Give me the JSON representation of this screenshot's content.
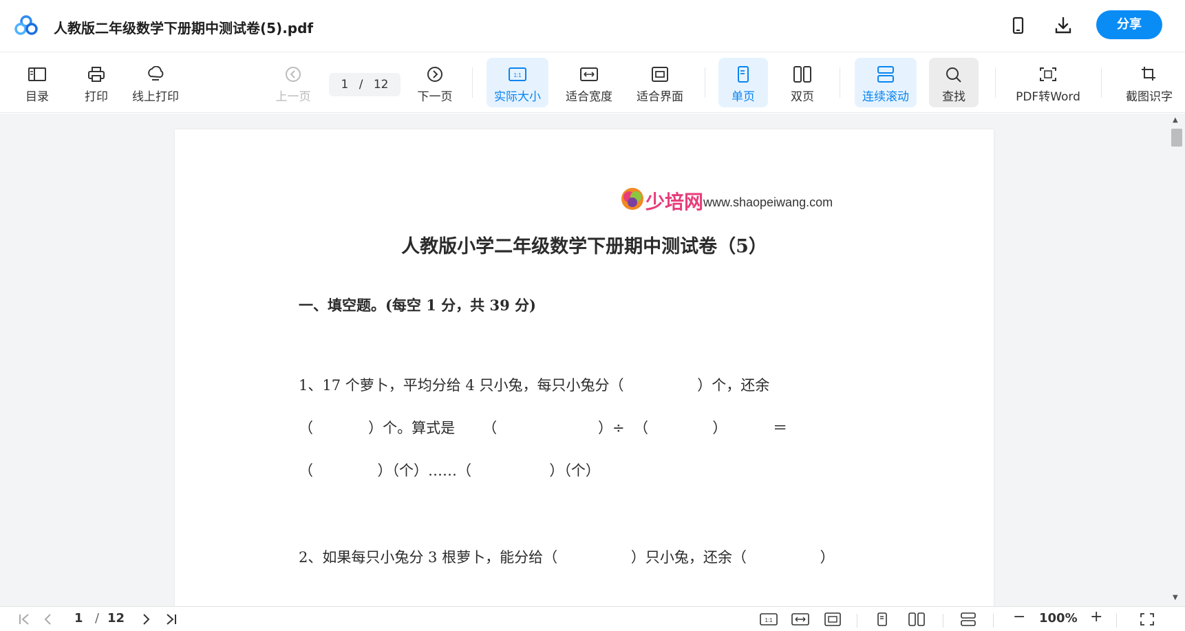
{
  "app": {
    "file_title": "人教版二年级数学下册期中测试卷(5).pdf",
    "share_label": "分享",
    "accent": "#0a8cf5"
  },
  "toolbar": {
    "toc": "目录",
    "print": "打印",
    "online_print": "线上打印",
    "prev_page": "上一页",
    "page_current": "1",
    "page_sep": "/",
    "page_total": "12",
    "next_page": "下一页",
    "actual_size": "实际大小",
    "fit_width": "适合宽度",
    "fit_screen": "适合界面",
    "single_page": "单页",
    "double_page": "双页",
    "continuous_scroll": "连续滚动",
    "find": "查找",
    "pdf_to_word": "PDF转Word",
    "screenshot_ocr": "截图识字",
    "actual_size_icon_text": "1:1"
  },
  "document": {
    "logo_text": "少培网",
    "logo_url": "www.shaopeiwang.com",
    "title": "人教版小学二年级数学下册期中测试卷（5）",
    "section1": "一、填空题。(每空 1 分，共 39 分)",
    "q1_line1": "1、17 个萝卜，平均分给 4 只小兔，每只小兔分（                ）个，还余",
    "q1_line2": "（            ）个。算式是      （                      ）÷  （              ）          ＝",
    "q1_line3": "（              ）（个）……（                 ）（个）",
    "q2_line1": "2、如果每只小兔分 3 根萝卜，能分给（                ）只小兔，还余（                ）"
  },
  "bottombar": {
    "page_current": "1",
    "page_sep": "/",
    "page_total": "12",
    "zoom": "100%",
    "zoom_minus": "−",
    "zoom_plus": "+"
  }
}
